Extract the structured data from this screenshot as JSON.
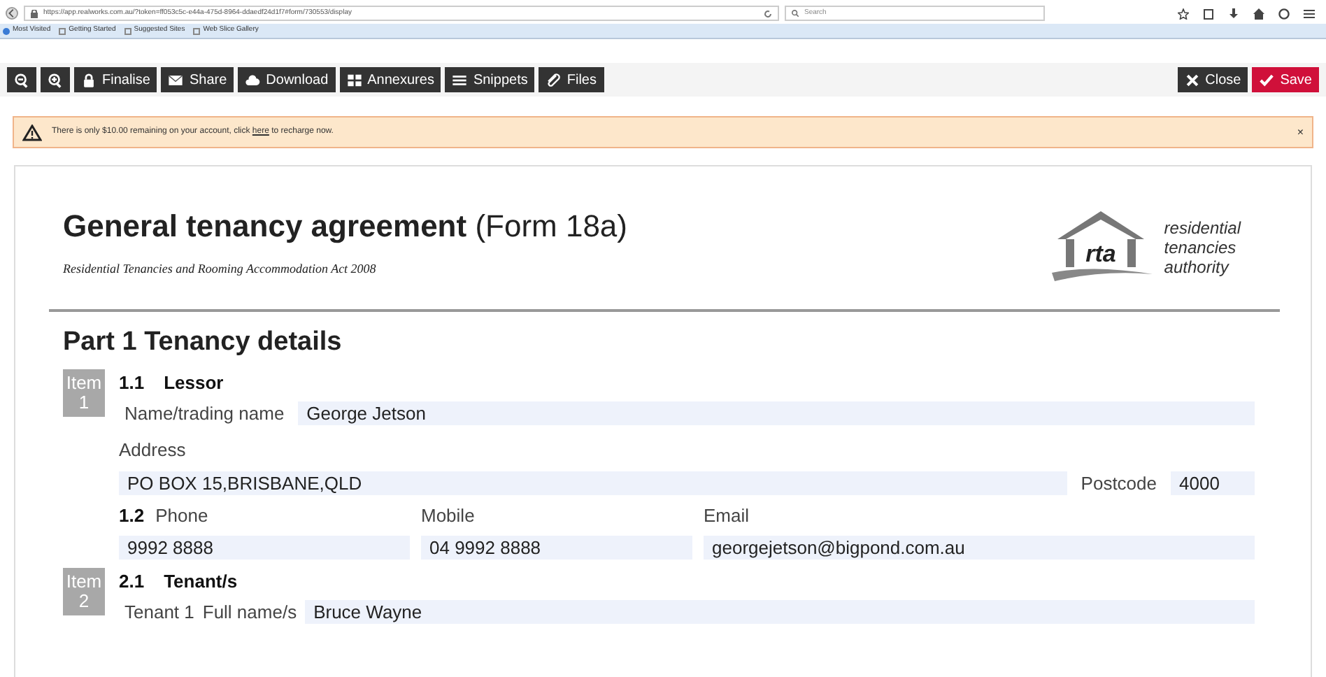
{
  "browser": {
    "url": "https://app.realworks.com.au/?token=ff053c5c-e44a-475d-8964-ddaedf24d1f7#form/730553/display",
    "search_placeholder": "Search",
    "bookmarks": [
      "Most Visited",
      "Getting Started",
      "Suggested Sites",
      "Web Slice Gallery"
    ]
  },
  "toolbar": {
    "left": [
      {
        "kind": "zoom-out"
      },
      {
        "kind": "zoom-in"
      },
      {
        "kind": "lock",
        "label": "Finalise"
      },
      {
        "kind": "mail",
        "label": "Share"
      },
      {
        "kind": "cloud",
        "label": "Download"
      },
      {
        "kind": "grid",
        "label": "Annexures"
      },
      {
        "kind": "list",
        "label": "Snippets"
      },
      {
        "kind": "clip",
        "label": "Files"
      }
    ],
    "right": [
      {
        "kind": "close",
        "label": "Close"
      },
      {
        "kind": "save",
        "label": "Save"
      }
    ]
  },
  "alert": {
    "before": "There is only $10.00 remaining on your account, click",
    "link": "here",
    "after": "to recharge now.",
    "close": "×"
  },
  "document": {
    "title": "**General tenancy agreement** (Form 18a)",
    "subtitle": "Residential Tenancies and Rooming Accommodation Act 2008",
    "logo": {
      "mark": "rta",
      "lines": [
        "residential",
        "tenancies",
        "authority"
      ]
    },
    "part": "Part 1  Tenancy details",
    "item1": {
      "badge": [
        "Item",
        "1"
      ],
      "number": "1.1",
      "heading": "Lessor",
      "name_label": "Name/trading name",
      "name": "George Jetson",
      "address_label": "Address",
      "address": "PO BOX 15,BRISBANE,QLD",
      "postcode_label": "Postcode",
      "postcode": "4000",
      "contact_number": "1.2",
      "phone_label": "Phone",
      "phone": "9992 8888",
      "mobile_label": "Mobile",
      "mobile": "04 9992 8888",
      "email_label": "Email",
      "email": "georgejetson@bigpond.com.au"
    },
    "item2": {
      "badge": [
        "Item",
        "2"
      ],
      "number": "2.1",
      "heading": "Tenant/s",
      "tenant_label": "Tenant 1",
      "fullname_label": "Full name/s",
      "fullname": "Bruce Wayne"
    }
  }
}
